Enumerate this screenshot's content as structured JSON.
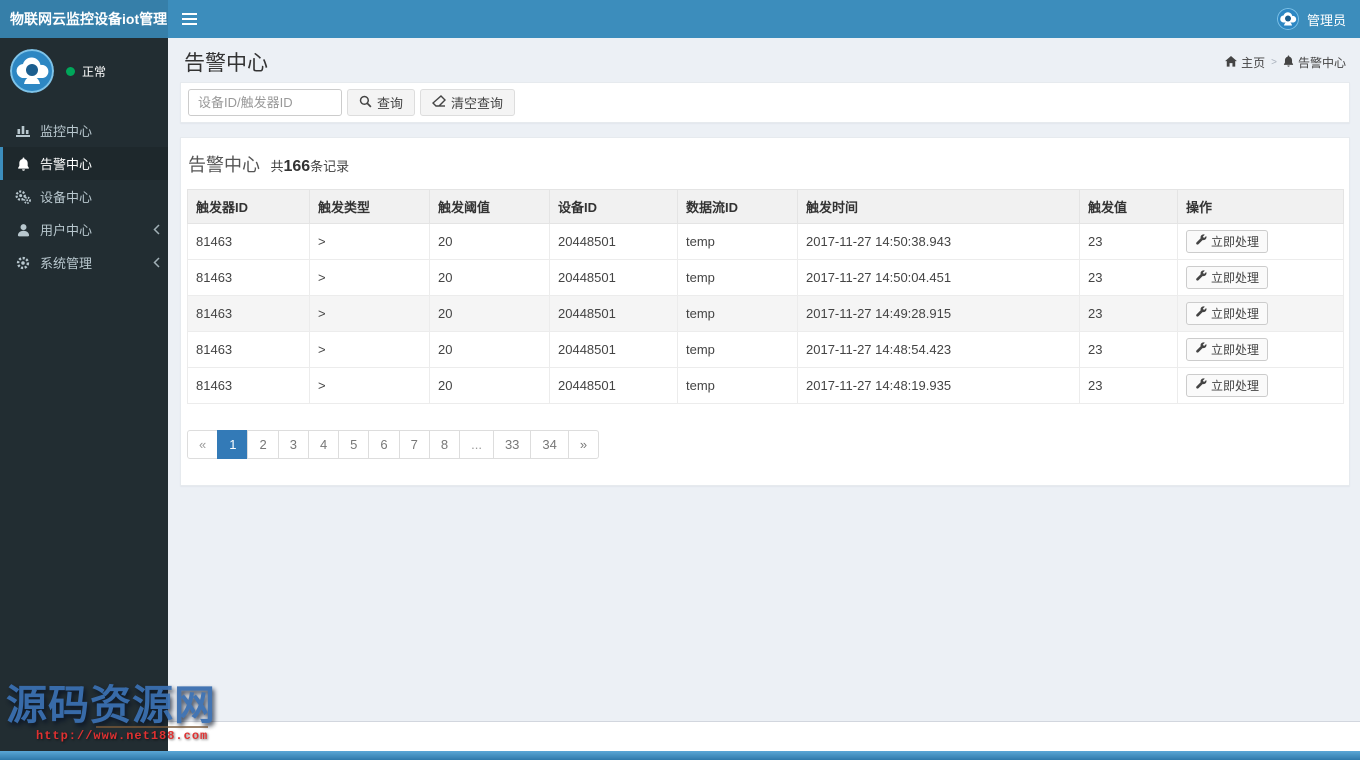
{
  "navbar": {
    "brand": "物联网云监控设备iot管理",
    "user": "管理员"
  },
  "sidebar": {
    "status_label": "正常",
    "items": [
      {
        "label": "监控中心",
        "icon": "bar-chart-icon",
        "active": false,
        "submenu": false
      },
      {
        "label": "告警中心",
        "icon": "bell-icon",
        "active": true,
        "submenu": false
      },
      {
        "label": "设备中心",
        "icon": "gears-icon",
        "active": false,
        "submenu": false
      },
      {
        "label": "用户中心",
        "icon": "user-icon",
        "active": false,
        "submenu": true
      },
      {
        "label": "系统管理",
        "icon": "gear-icon",
        "active": false,
        "submenu": true
      }
    ]
  },
  "page": {
    "title": "告警中心",
    "breadcrumb": {
      "home": "主页",
      "current": "告警中心"
    }
  },
  "search": {
    "placeholder": "设备ID/触发器ID",
    "query_button": "查询",
    "clear_button": "清空查询"
  },
  "alerts": {
    "box_title": "告警中心",
    "count_prefix": "共",
    "count": "166",
    "count_suffix": "条记录",
    "columns": [
      "触发器ID",
      "触发类型",
      "触发阈值",
      "设备ID",
      "数据流ID",
      "触发时间",
      "触发值",
      "操作"
    ],
    "action_label": "立即处理",
    "rows": [
      {
        "trigger_id": "81463",
        "type": ">",
        "threshold": "20",
        "device_id": "20448501",
        "stream_id": "temp",
        "time": "2017-11-27 14:50:38.943",
        "value": "23",
        "highlighted": false
      },
      {
        "trigger_id": "81463",
        "type": ">",
        "threshold": "20",
        "device_id": "20448501",
        "stream_id": "temp",
        "time": "2017-11-27 14:50:04.451",
        "value": "23",
        "highlighted": false
      },
      {
        "trigger_id": "81463",
        "type": ">",
        "threshold": "20",
        "device_id": "20448501",
        "stream_id": "temp",
        "time": "2017-11-27 14:49:28.915",
        "value": "23",
        "highlighted": true
      },
      {
        "trigger_id": "81463",
        "type": ">",
        "threshold": "20",
        "device_id": "20448501",
        "stream_id": "temp",
        "time": "2017-11-27 14:48:54.423",
        "value": "23",
        "highlighted": false
      },
      {
        "trigger_id": "81463",
        "type": ">",
        "threshold": "20",
        "device_id": "20448501",
        "stream_id": "temp",
        "time": "2017-11-27 14:48:19.935",
        "value": "23",
        "highlighted": false
      }
    ]
  },
  "pagination": {
    "prev_label": "«",
    "next_label": "»",
    "pages": [
      "1",
      "2",
      "3",
      "4",
      "5",
      "6",
      "7",
      "8",
      "...",
      "33",
      "34"
    ],
    "active_page": "1"
  },
  "watermark": {
    "text": "源码资源网",
    "url": "http://www.net188.com"
  },
  "colors": {
    "navbar": "#3c8dbc",
    "navbar_brand": "#367fa9",
    "sidebar": "#222d32",
    "active_accent": "#3c8dbc",
    "pagination_active": "#337ab7",
    "status_green": "#00a65a",
    "content_bg": "#ecf0f5"
  }
}
